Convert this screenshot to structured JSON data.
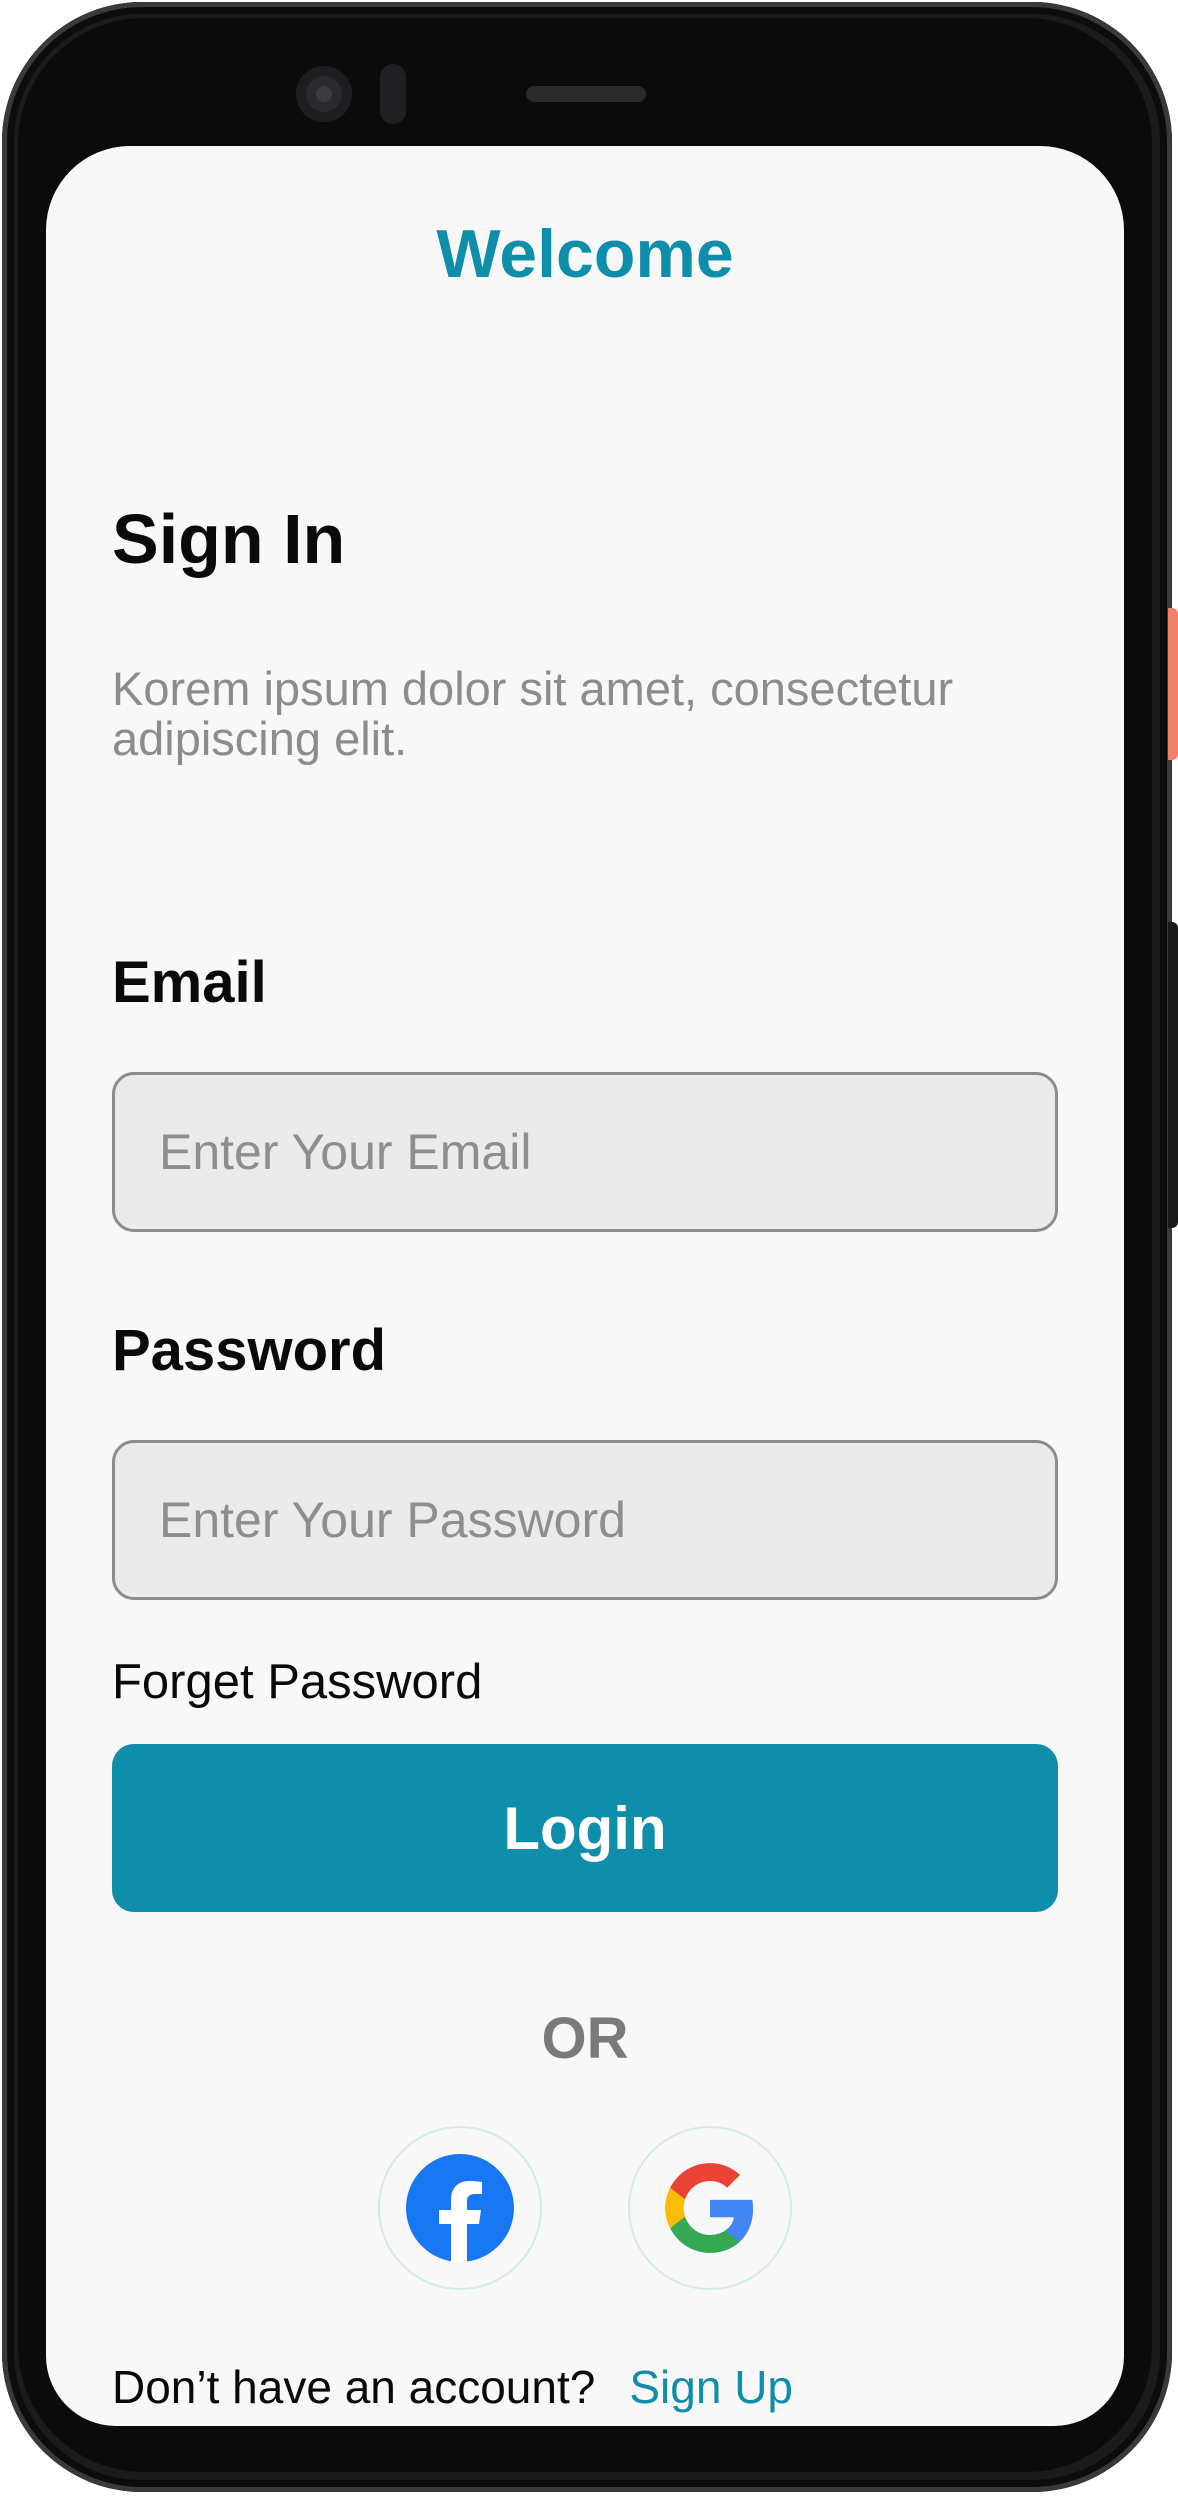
{
  "header": {
    "title": "Welcome"
  },
  "signin": {
    "heading": "Sign In",
    "subtitle": "Korem ipsum dolor sit amet, consectetur adipiscing elit."
  },
  "form": {
    "email_label": "Email",
    "email_placeholder": "Enter Your Email",
    "email_value": "",
    "password_label": "Password",
    "password_placeholder": "Enter Your Password",
    "password_value": "",
    "forget_password": "Forget Password",
    "login_button": "Login"
  },
  "social": {
    "divider": "OR",
    "providers": [
      {
        "name": "facebook",
        "icon": "facebook-icon",
        "color": "#1877f2"
      },
      {
        "name": "google",
        "icon": "google-icon",
        "colors": [
          "#4285f4",
          "#34a853",
          "#fbbc05",
          "#ea4335"
        ]
      }
    ]
  },
  "footer": {
    "question": "Don’t have an account?",
    "signup_link": "Sign Up"
  },
  "theme": {
    "accent": "#0f8eab",
    "background": "#f8f8f8",
    "input_background": "#ebebeb",
    "muted_text": "#8c8c8c"
  }
}
